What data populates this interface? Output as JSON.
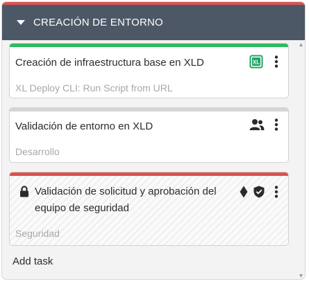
{
  "colors": {
    "phase_accent": "#d9534f",
    "phase_header_bg": "#4d5866",
    "task_done": "#2fba5e",
    "task_planned": "#d5d5d5",
    "task_failed": "#d9534f",
    "icon_dark": "#2b2b2b",
    "excel_green": "#21a366"
  },
  "phase": {
    "title": "CREACIÓN DE ENTORNO",
    "toggle_icon": "caret-down-icon"
  },
  "tasks": [
    {
      "title": "Creación de infraestructura base en XLD",
      "subtitle": "XL Deploy CLI: Run Script from URL",
      "status": "completed",
      "type_icon": "xl-script-icon",
      "type_icon_text": "XL",
      "menu_icon": "kebab-menu-icon"
    },
    {
      "title": "Validación de entorno en XLD",
      "subtitle": "Desarrollo",
      "status": "planned",
      "type_icon": "users-icon",
      "menu_icon": "kebab-menu-icon"
    },
    {
      "title_line1": "Validación de solicitud y aprobación del",
      "title_line2": "equipo de seguridad",
      "subtitle": "Seguridad",
      "status": "failed",
      "lock_icon": "lock-icon",
      "type_icons": [
        "diamond-icon",
        "shield-check-icon"
      ],
      "menu_icon": "kebab-menu-icon"
    }
  ],
  "add_task_label": "Add task"
}
